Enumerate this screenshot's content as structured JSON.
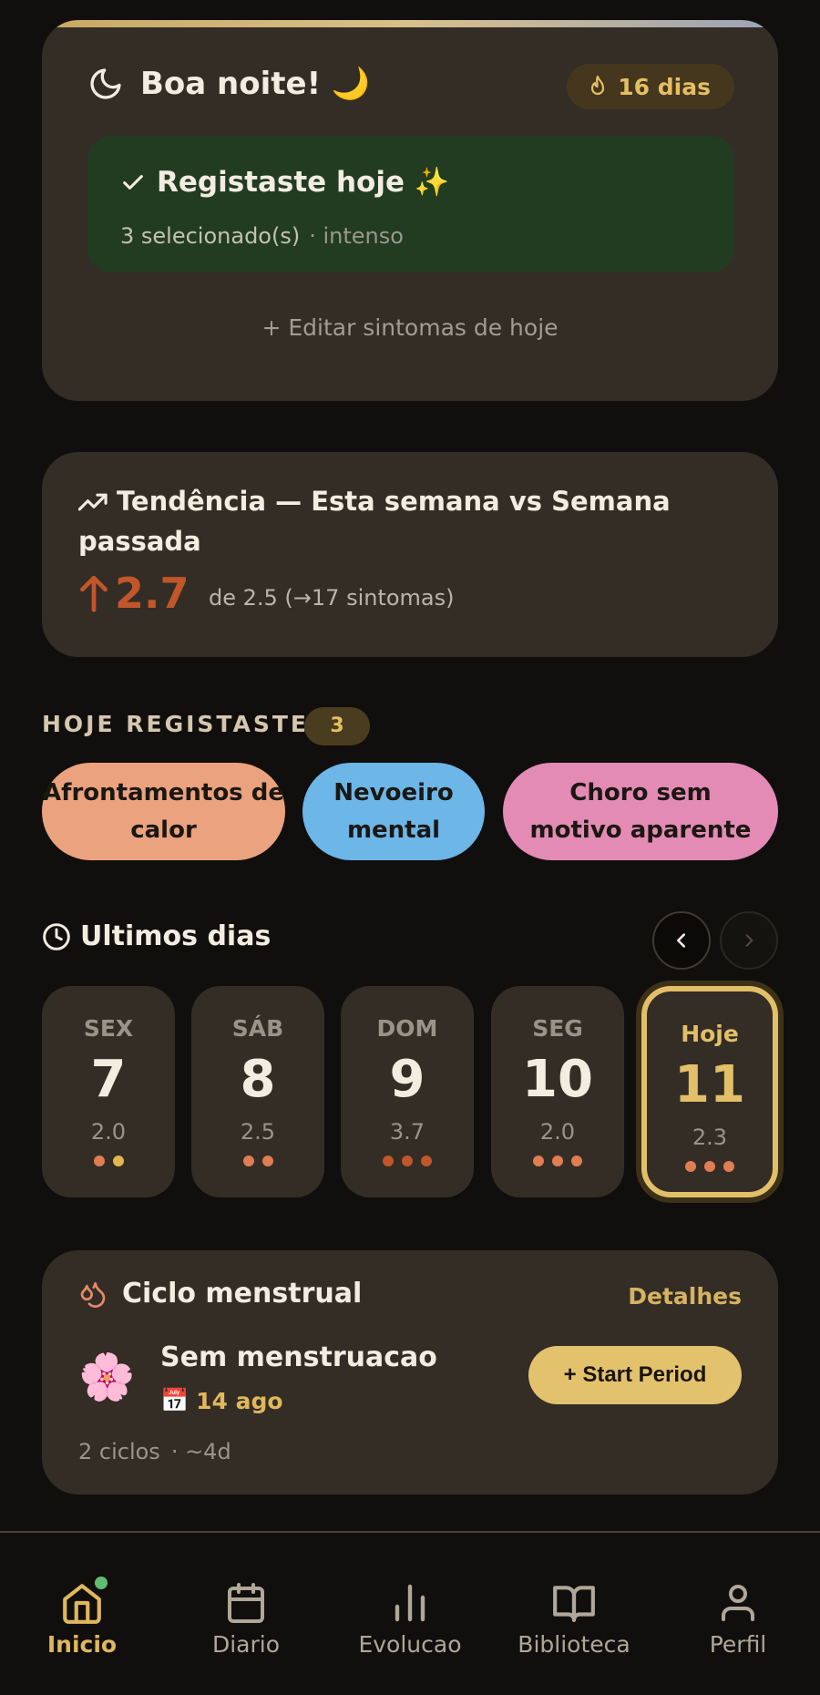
{
  "greeting": {
    "title": "Boa noite! 🌙",
    "streak": "16 dias",
    "logged_title": "Registaste hoje ✨",
    "logged_selected": "3 selecionado(s)",
    "logged_intensity": "· intenso",
    "edit_link": "+ Editar sintomas de hoje"
  },
  "trend": {
    "title": "Tendência — Esta semana vs Semana passada",
    "value": "2.7",
    "note": "de 2.5 (→17 sintomas)"
  },
  "today_logged": {
    "label": "HOJE REGISTASTE",
    "count": "3",
    "symptoms": [
      {
        "label": "Afrontamentos de calor",
        "color": "#eba27e"
      },
      {
        "label": "Nevoeiro mental",
        "color": "#6cb6e8"
      },
      {
        "label": "Choro sem motivo aparente",
        "color": "#e38bb5"
      }
    ]
  },
  "recent_days": {
    "title": "Ultimos dias",
    "days": [
      {
        "name": "SEX",
        "num": "7",
        "val": "2.0",
        "dots": [
          "#e07e52",
          "#e1b84f"
        ]
      },
      {
        "name": "SÁB",
        "num": "8",
        "val": "2.5",
        "dots": [
          "#e07e52",
          "#e07e52"
        ]
      },
      {
        "name": "DOM",
        "num": "9",
        "val": "3.7",
        "dots": [
          "#c1562a",
          "#c1562a",
          "#c1562a"
        ]
      },
      {
        "name": "SEG",
        "num": "10",
        "val": "2.0",
        "dots": [
          "#e07e52",
          "#e07e52",
          "#e07e52"
        ]
      },
      {
        "name": "Hoje",
        "num": "11",
        "val": "2.3",
        "dots": [
          "#e07e52",
          "#e07e52",
          "#e07e52"
        ]
      }
    ]
  },
  "cycle": {
    "title": "Ciclo menstrual",
    "details": "Detalhes",
    "flower": "🌸",
    "state": "Sem menstruacao",
    "date_icon": "📅",
    "date": "14 ago",
    "start_button": "+ Start Period",
    "cycles": "2 ciclos",
    "length": "· ~4d"
  },
  "nav": {
    "home": "Inicio",
    "diary": "Diario",
    "evolution": "Evolucao",
    "library": "Biblioteca",
    "profile": "Perfil"
  },
  "colors": {
    "accent": "#e0b75c",
    "card": "#332d26",
    "background": "#110f0d",
    "trend_up": "#c1562a"
  }
}
